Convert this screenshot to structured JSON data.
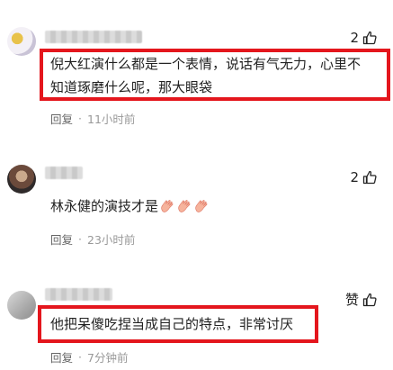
{
  "comments": [
    {
      "likes": "2",
      "text_lines": [
        "倪大红演什么都是一个表情，说话有气无力，心里不",
        "知道琢磨什么呢，那大眼袋"
      ],
      "reply": "回复",
      "time": "11小时前"
    },
    {
      "likes": "2",
      "text": "林永健的演技才是",
      "reply": "回复",
      "time": "23小时前"
    },
    {
      "likes": "赞",
      "text": "他把呆傻吃捏当成自己的特点，非常讨厌",
      "reply": "回复",
      "time": "7分钟前"
    }
  ],
  "separator": "·",
  "icons": {
    "like": "thumbs-up-icon",
    "emoji": "clapping-hands-emoji"
  },
  "colors": {
    "highlight": "#e4161d",
    "meta": "#999999"
  }
}
